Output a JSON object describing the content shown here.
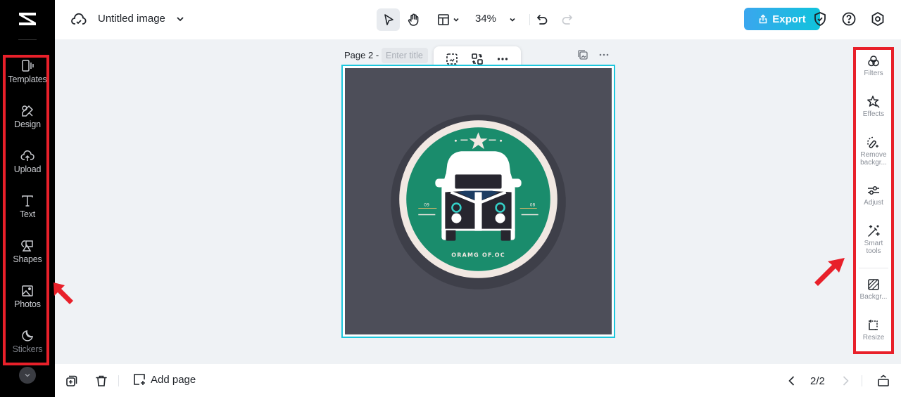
{
  "app": {
    "logo": "capcut-logo"
  },
  "topbar": {
    "document_title": "Untitled image",
    "zoom_level": "34%",
    "export_label": "Export",
    "tools": [
      "select",
      "hand",
      "layout",
      "undo",
      "redo"
    ]
  },
  "left_rail": {
    "items": [
      {
        "label": "Templates",
        "icon": "templates-icon"
      },
      {
        "label": "Design",
        "icon": "design-icon"
      },
      {
        "label": "Upload",
        "icon": "upload-icon"
      },
      {
        "label": "Text",
        "icon": "text-icon"
      },
      {
        "label": "Shapes",
        "icon": "shapes-icon"
      },
      {
        "label": "Photos",
        "icon": "photos-icon"
      },
      {
        "label": "Stickers",
        "icon": "stickers-icon"
      }
    ]
  },
  "canvas": {
    "page_label": "Page 2 -",
    "title_placeholder": "Enter title",
    "image_text": "ORAMG OF.OC",
    "colors": {
      "background": "#4d4e59",
      "badge_green": "#1a8c6c",
      "badge_ring": "#f1e8e2",
      "selection": "#1cc6dc"
    }
  },
  "right_panel": {
    "items": [
      {
        "label": "Filters",
        "icon": "filters-icon"
      },
      {
        "label": "Effects",
        "icon": "effects-icon"
      },
      {
        "label": "Remove backgr...",
        "icon": "remove-background-icon"
      },
      {
        "label": "Adjust",
        "icon": "adjust-icon"
      },
      {
        "label": "Smart tools",
        "icon": "smart-tools-icon"
      },
      {
        "label": "Backgr...",
        "icon": "background-icon"
      },
      {
        "label": "Resize",
        "icon": "resize-icon"
      }
    ]
  },
  "bottombar": {
    "add_page_label": "Add page",
    "page_indicator": "2/2"
  },
  "colors": {
    "accent": "#10c3dc",
    "annotation_red": "#e8202a",
    "rail_bg": "#000000"
  }
}
